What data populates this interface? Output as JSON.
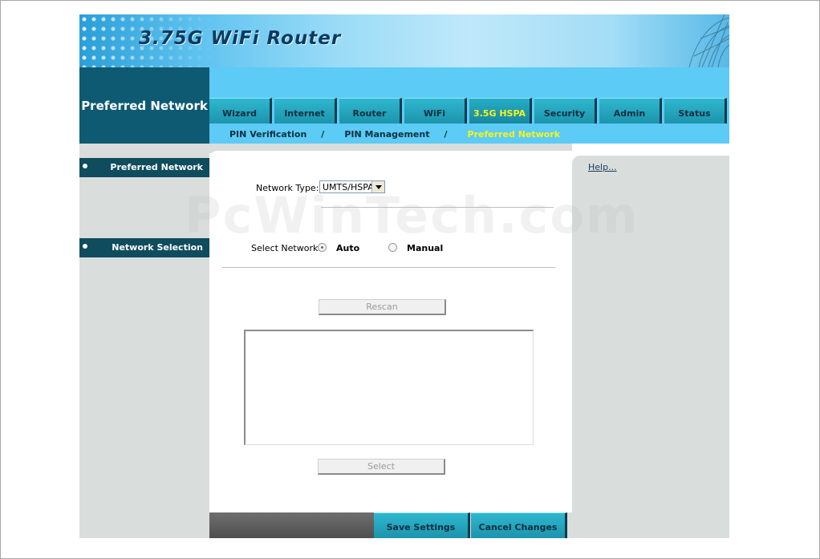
{
  "header": {
    "title": "3.75G WiFi Router",
    "section_title": "Preferred Network"
  },
  "tabs": [
    {
      "label": "Wizard",
      "active": false
    },
    {
      "label": "Internet",
      "active": false
    },
    {
      "label": "Router",
      "active": false
    },
    {
      "label": "WiFi",
      "active": false
    },
    {
      "label": "3.5G HSPA",
      "active": true
    },
    {
      "label": "Security",
      "active": false
    },
    {
      "label": "Admin",
      "active": false
    },
    {
      "label": "Status",
      "active": false
    }
  ],
  "subnav": {
    "items": [
      "PIN Verification",
      "PIN Management",
      "Preferred Network"
    ],
    "separator": "/",
    "active_index": 2
  },
  "sidebar": {
    "items": [
      "Preferred Network",
      "Network Selection"
    ]
  },
  "help": {
    "label": "Help..."
  },
  "form": {
    "network_type_label": "Network Type:",
    "network_type_value": "UMTS/HSPA",
    "select_network_label": "Select Network:",
    "radio_auto": "Auto",
    "radio_manual": "Manual",
    "selected_radio": "Auto",
    "rescan_label": "Rescan",
    "select_label": "Select"
  },
  "footer": {
    "save_label": "Save Settings",
    "cancel_label": "Cancel Changes"
  },
  "watermark": "PcWinTech.com",
  "colors": {
    "nav_bg": "#5ccbf5",
    "tab_bg": "#2fb7cf",
    "active_tab_text": "#f7f31a",
    "sidebar_item_bg": "#0f4c5e",
    "section_title_bg": "#0e5a72",
    "panel_gray": "#d9dedd"
  }
}
